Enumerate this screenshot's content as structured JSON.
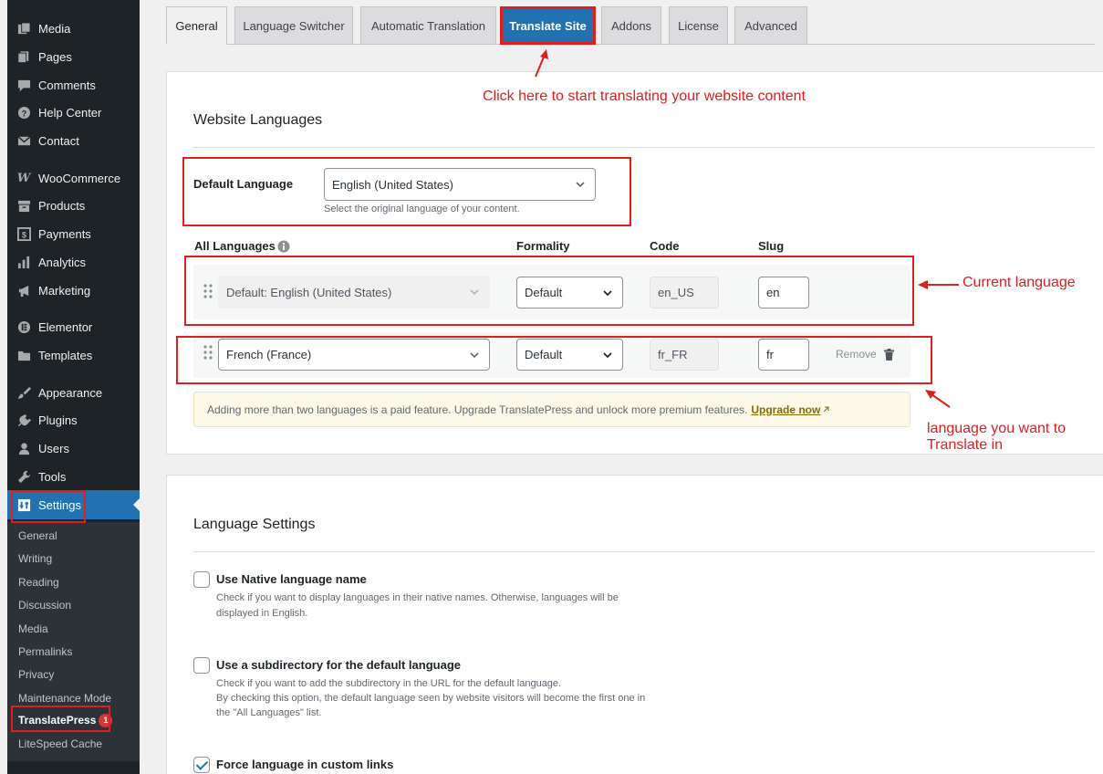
{
  "sidebar": {
    "items": [
      {
        "label": "Media",
        "icon": "media-icon"
      },
      {
        "label": "Pages",
        "icon": "pages-icon"
      },
      {
        "label": "Comments",
        "icon": "comments-icon"
      },
      {
        "label": "Help Center",
        "icon": "help-icon"
      },
      {
        "label": "Contact",
        "icon": "mail-icon"
      },
      {
        "label": "WooCommerce",
        "icon": "woocommerce-icon"
      },
      {
        "label": "Products",
        "icon": "products-icon"
      },
      {
        "label": "Payments",
        "icon": "payments-icon"
      },
      {
        "label": "Analytics",
        "icon": "analytics-icon"
      },
      {
        "label": "Marketing",
        "icon": "megaphone-icon"
      },
      {
        "label": "Elementor",
        "icon": "elementor-icon"
      },
      {
        "label": "Templates",
        "icon": "folder-icon"
      },
      {
        "label": "Appearance",
        "icon": "paintbrush-icon"
      },
      {
        "label": "Plugins",
        "icon": "plugin-icon"
      },
      {
        "label": "Users",
        "icon": "users-icon"
      },
      {
        "label": "Tools",
        "icon": "wrench-icon"
      },
      {
        "label": "Settings",
        "icon": "settings-icon"
      }
    ],
    "submenu": [
      "General",
      "Writing",
      "Reading",
      "Discussion",
      "Media",
      "Permalinks",
      "Privacy",
      "Maintenance Mode",
      "TranslatePress",
      "LiteSpeed Cache"
    ],
    "translatepress_badge": "1"
  },
  "tabs": [
    "General",
    "Language Switcher",
    "Automatic Translation",
    "Translate Site",
    "Addons",
    "License",
    "Advanced"
  ],
  "annotations": {
    "tab_hint": "Click here to start translating your website content",
    "current_language": "Current language",
    "translate_in_line1": "language you want to",
    "translate_in_line2": "Translate in"
  },
  "website_languages": {
    "title": "Website Languages",
    "default_language_label": "Default Language",
    "default_language_value": "English (United States)",
    "default_language_help": "Select the original language of your content.",
    "columns": {
      "all_languages": "All Languages",
      "formality": "Formality",
      "code": "Code",
      "slug": "Slug"
    },
    "rows": [
      {
        "language": "Default: English (United States)",
        "formality": "Default",
        "code": "en_US",
        "slug": "en"
      },
      {
        "language": "French (France)",
        "formality": "Default",
        "code": "fr_FR",
        "slug": "fr",
        "remove": "Remove"
      }
    ],
    "notice_text": "Adding more than two languages is a paid feature. Upgrade TranslatePress and unlock more premium features.",
    "notice_link": "Upgrade now"
  },
  "language_settings": {
    "title": "Language Settings",
    "options": [
      {
        "label": "Use Native language name",
        "help1": "Check if you want to display languages in their native names. Otherwise, languages will be",
        "help2": "displayed in English.",
        "help3": "",
        "checked": false
      },
      {
        "label": "Use a subdirectory for the default language",
        "help1": "Check if you want to add the subdirectory in the URL for the default language.",
        "help2": "By checking this option, the default language seen by website visitors will become the first one in",
        "help3": "the \"All Languages\" list.",
        "checked": false
      },
      {
        "label": "Force language in custom links",
        "help1": "",
        "help2": "",
        "help3": "",
        "checked": true
      }
    ]
  },
  "colors": {
    "accent": "#2271b1",
    "annotation_red": "#e01e1e",
    "sidebar_bg": "#1d2327"
  }
}
